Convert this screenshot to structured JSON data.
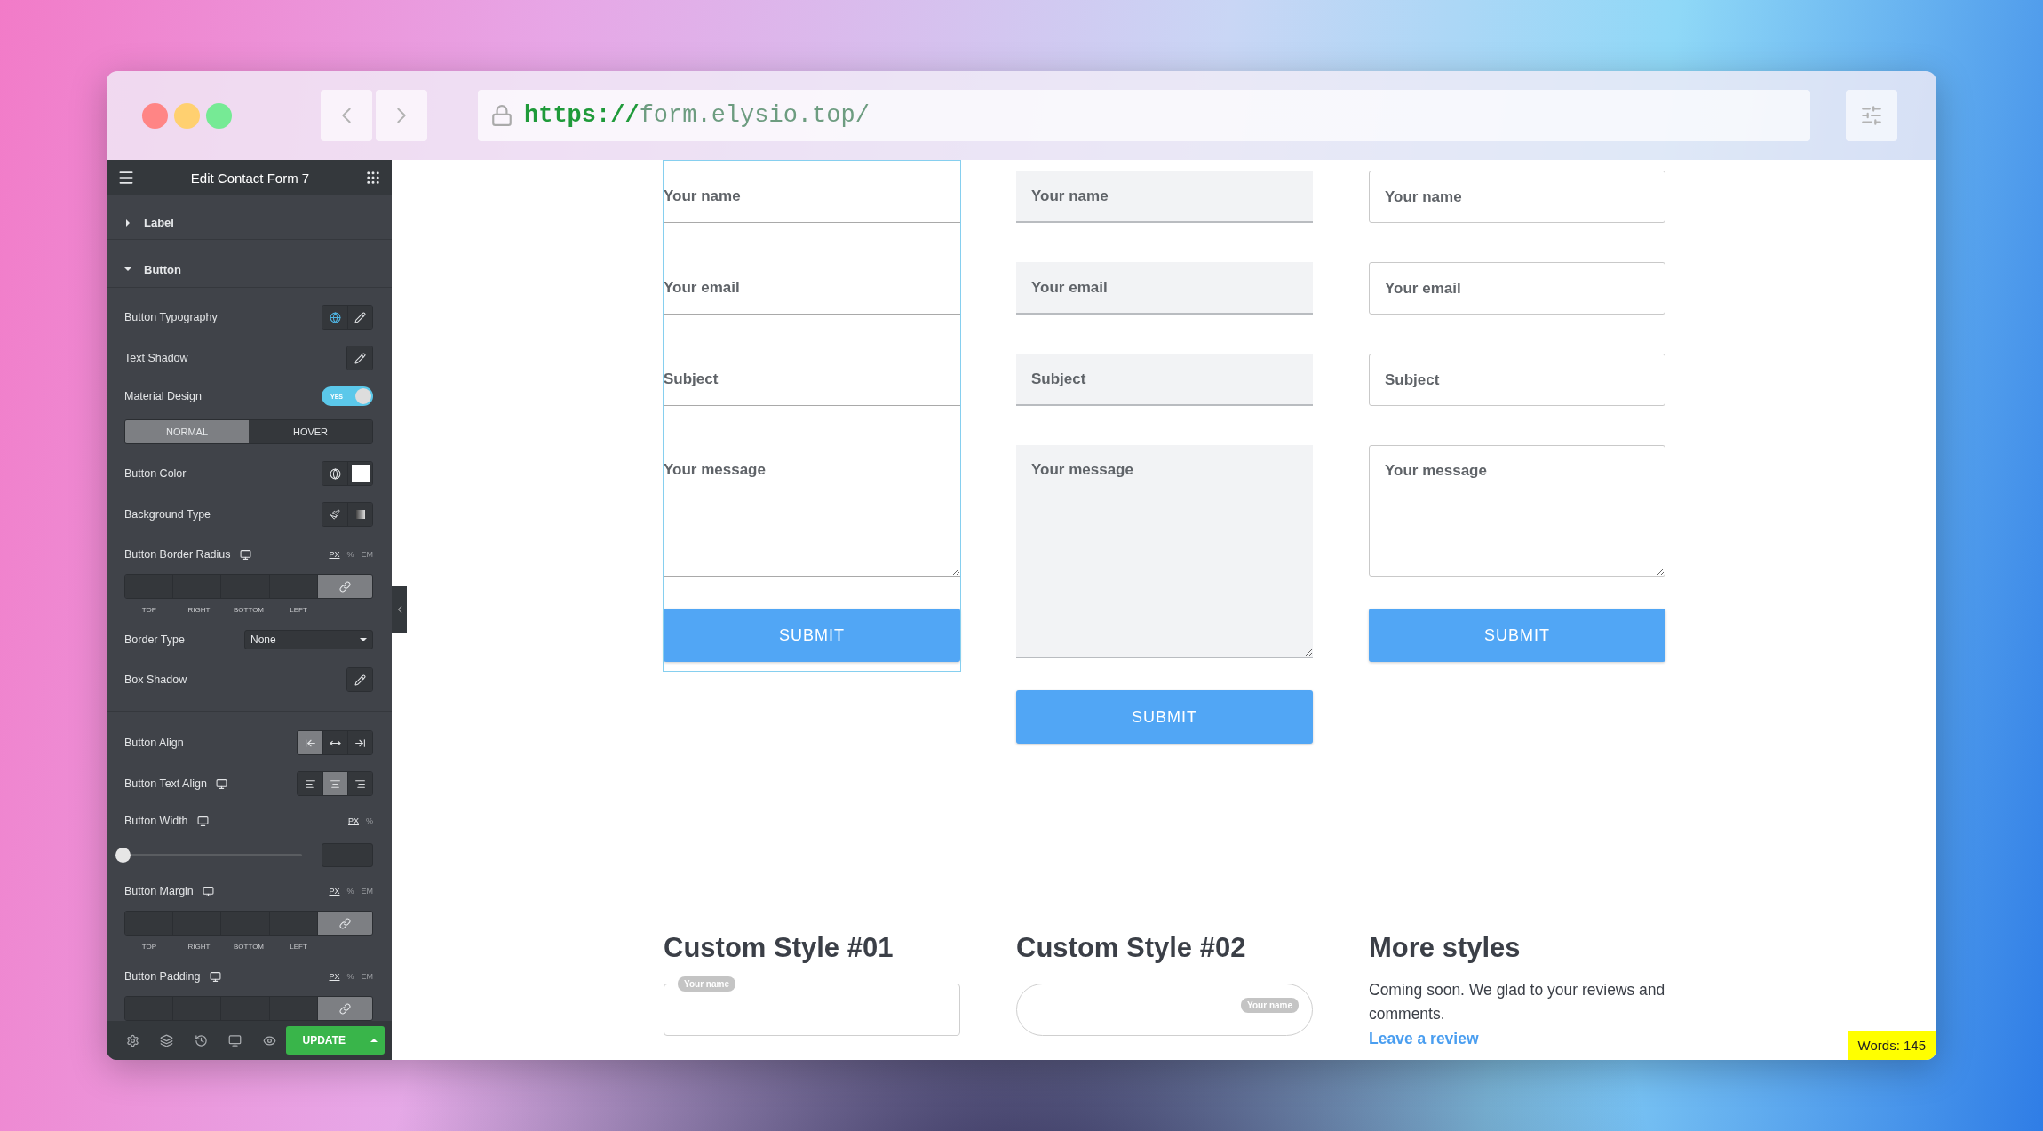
{
  "browser": {
    "url_scheme": "https://",
    "url_host": "form.elysio.top/"
  },
  "panel": {
    "title": "Edit Contact Form 7",
    "sections": [
      {
        "title": "Label",
        "expanded": false
      },
      {
        "title": "Button",
        "expanded": true
      }
    ],
    "controls": [
      {
        "kind": "actions",
        "label": "Button Typography",
        "global": true,
        "edit": true
      },
      {
        "kind": "actions",
        "label": "Text Shadow",
        "edit": true
      },
      {
        "kind": "switch",
        "label": "Material Design",
        "on": true,
        "text": "YES"
      },
      {
        "kind": "tabs",
        "tabs": [
          {
            "label": "NORMAL",
            "selected": true
          },
          {
            "label": "HOVER",
            "selected": false
          }
        ]
      },
      {
        "kind": "color",
        "label": "Button Color"
      },
      {
        "kind": "background",
        "label": "Background Type"
      },
      {
        "kind": "dimensions",
        "label": "Button Border Radius",
        "responsive": true,
        "units": [
          {
            "label": "PX",
            "selected": true
          },
          {
            "label": "%",
            "selected": false
          },
          {
            "label": "EM",
            "selected": false
          }
        ],
        "linked": true,
        "sides": [
          "TOP",
          "RIGHT",
          "BOTTOM",
          "LEFT"
        ]
      },
      {
        "kind": "select",
        "label": "Border Type",
        "value": "None"
      },
      {
        "kind": "actions",
        "label": "Box Shadow",
        "edit": true
      },
      {
        "kind": "divider"
      },
      {
        "kind": "choose",
        "label": "Button Align",
        "options": [
          {
            "kind": "start",
            "selected": true
          },
          {
            "kind": "middle",
            "selected": false
          },
          {
            "kind": "end",
            "selected": false
          }
        ]
      },
      {
        "kind": "choose",
        "label": "Button Text Align",
        "responsive": true,
        "options": [
          {
            "kind": "left",
            "selected": false
          },
          {
            "kind": "center",
            "selected": true
          },
          {
            "kind": "right",
            "selected": false
          }
        ]
      },
      {
        "kind": "slider",
        "label": "Button Width",
        "responsive": true,
        "units": [
          {
            "label": "PX",
            "selected": true
          },
          {
            "label": "%",
            "selected": false
          }
        ],
        "level": 0
      },
      {
        "kind": "dimensions",
        "label": "Button Margin",
        "responsive": true,
        "units": [
          {
            "label": "PX",
            "selected": true
          },
          {
            "label": "%",
            "selected": false
          },
          {
            "label": "EM",
            "selected": false
          }
        ],
        "linked": true,
        "sides": [
          "TOP",
          "RIGHT",
          "BOTTOM",
          "LEFT"
        ]
      },
      {
        "kind": "dimensions",
        "label": "Button Padding",
        "responsive": true,
        "units": [
          {
            "label": "PX",
            "selected": true
          },
          {
            "label": "%",
            "selected": false
          },
          {
            "label": "EM",
            "selected": false
          }
        ],
        "linked": true
      }
    ],
    "update": "UPDATE"
  },
  "forms": [
    {
      "kind": "underline",
      "selected": true,
      "fields": [
        {
          "kind": "input",
          "placeholder": "Your name"
        },
        {
          "kind": "input",
          "placeholder": "Your email"
        },
        {
          "kind": "input",
          "placeholder": "Subject"
        },
        {
          "kind": "textarea",
          "placeholder": "Your message"
        }
      ],
      "submit": "SUBMIT"
    },
    {
      "kind": "filled",
      "selected": false,
      "fields": [
        {
          "kind": "input",
          "placeholder": "Your name"
        },
        {
          "kind": "input",
          "placeholder": "Your email"
        },
        {
          "kind": "input",
          "placeholder": "Subject"
        },
        {
          "kind": "textarea",
          "placeholder": "Your message"
        }
      ],
      "submit": "SUBMIT"
    },
    {
      "kind": "outlined",
      "selected": false,
      "fields": [
        {
          "kind": "input",
          "placeholder": "Your name"
        },
        {
          "kind": "input",
          "placeholder": "Your email"
        },
        {
          "kind": "input",
          "placeholder": "Subject"
        },
        {
          "kind": "textarea",
          "placeholder": "Your message"
        }
      ],
      "submit": "SUBMIT"
    }
  ],
  "styles": [
    {
      "kind": "floating",
      "heading": "Custom Style #01",
      "label": "Your name"
    },
    {
      "kind": "pill",
      "heading": "Custom Style #02",
      "label": "Your name"
    },
    {
      "kind": "note",
      "heading": "More styles",
      "text": "Coming soon. We glad to your reviews and comments.",
      "link": "Leave a review"
    }
  ],
  "word_count": "Words: 145"
}
